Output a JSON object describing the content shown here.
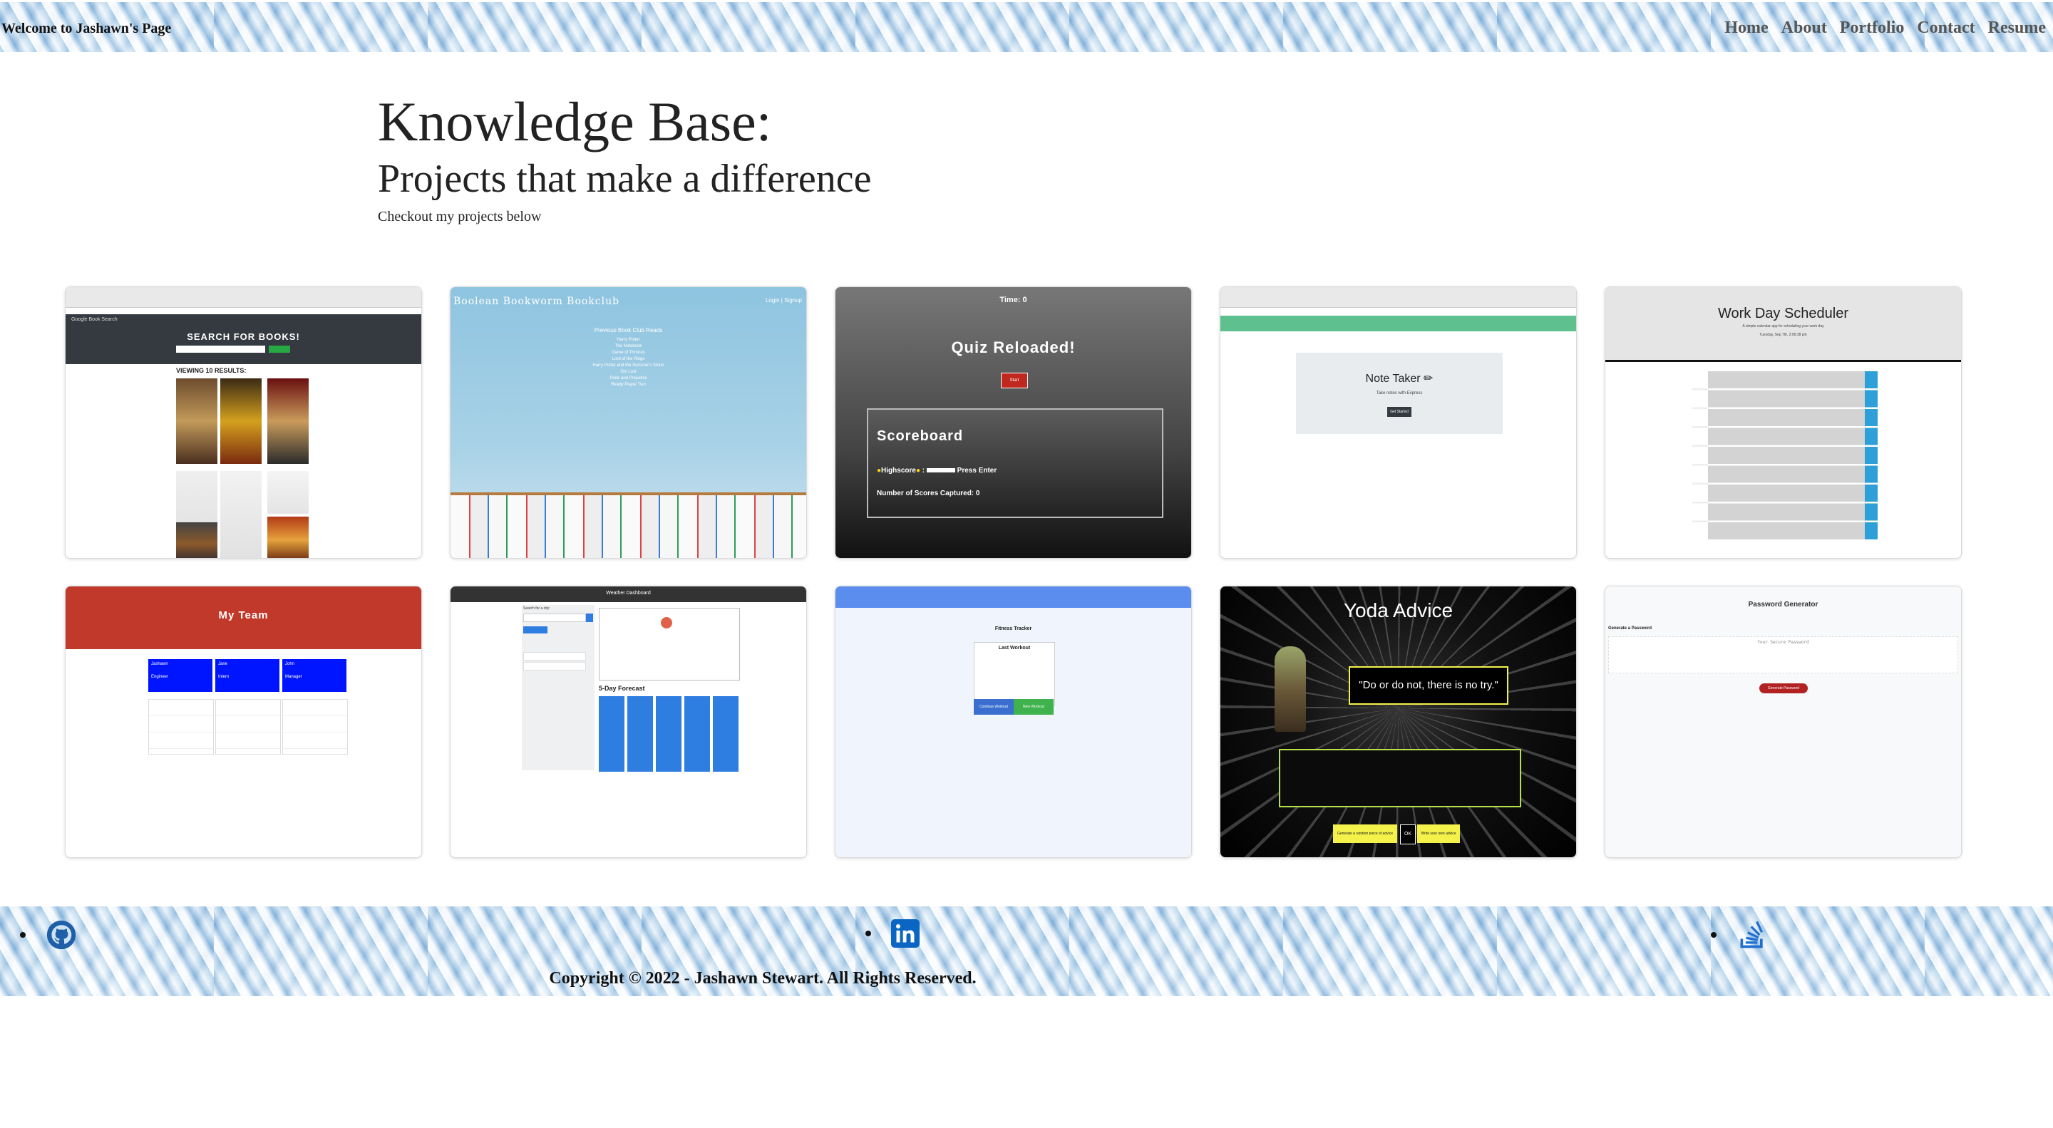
{
  "header": {
    "title": "Welcome to Jashawn's Page",
    "nav": [
      "Home",
      "About",
      "Portfolio",
      "Contact",
      "Resume"
    ]
  },
  "hero": {
    "heading": "Knowledge Base:",
    "subheading": "Projects that make a difference",
    "tagline": "Checkout my projects below"
  },
  "projects": [
    {
      "name": "Google Book Search",
      "banner": "Search for Books!",
      "results_label": "Viewing 10 results:"
    },
    {
      "name": "Boolean Bookworm Bookclub",
      "nav_right": "Login | Signup",
      "list_title": "Previous Book Club Reads"
    },
    {
      "name": "Quiz Reloaded!",
      "timer": "Time: 0",
      "start": "Start",
      "scoreboard": "Scoreboard",
      "highscore_label": "Highscore",
      "press_enter": "Press Enter",
      "scores_captured": "Number of Scores Captured: 0"
    },
    {
      "name": "Note Taker",
      "subtitle": "Take notes with Express",
      "button": "Get Started"
    },
    {
      "name": "Work Day Scheduler",
      "subtitle": "A simple calendar app for scheduling your work day",
      "date": "Tuesday, Sep 7th, 2:06:38 pm"
    },
    {
      "name": "My Team",
      "members": [
        {
          "name": "Jashawn",
          "role": "Engineer"
        },
        {
          "name": "Jane",
          "role": "Intern"
        },
        {
          "name": "John",
          "role": "Manager"
        }
      ]
    },
    {
      "name": "Weather Dashboard",
      "forecast_label": "5-Day Forecast",
      "search_label": "Search for a city:"
    },
    {
      "name": "Fitness Tracker",
      "card_title": "Last Workout",
      "button_left": "Continue Workout",
      "button_right": "New Workout"
    },
    {
      "name": "Yoda Advice",
      "quote": "\"Do or do not, there is no try.\"",
      "left_button": "Generate a random piece of advice",
      "ok": "OK",
      "right_button": "Write your own advice"
    },
    {
      "name": "Password Generator",
      "subtitle": "Generate a Password",
      "placeholder": "Your Secure Password",
      "button": "Generate Password"
    }
  ],
  "footer": {
    "copyright": "Copyright © 2022 - Jashawn Stewart. All Rights Reserved."
  },
  "colors": {
    "nav_text": "#555555",
    "team_red": "#c0392b",
    "team_blue": "#0015ff",
    "fitness_blue": "#5b8def",
    "yoda_yellow": "#f4f24a",
    "password_red": "#b22222",
    "github_blue": "#1f5fa8",
    "linkedin_blue": "#0a66c2",
    "stack_blue": "#1f6fd1"
  }
}
